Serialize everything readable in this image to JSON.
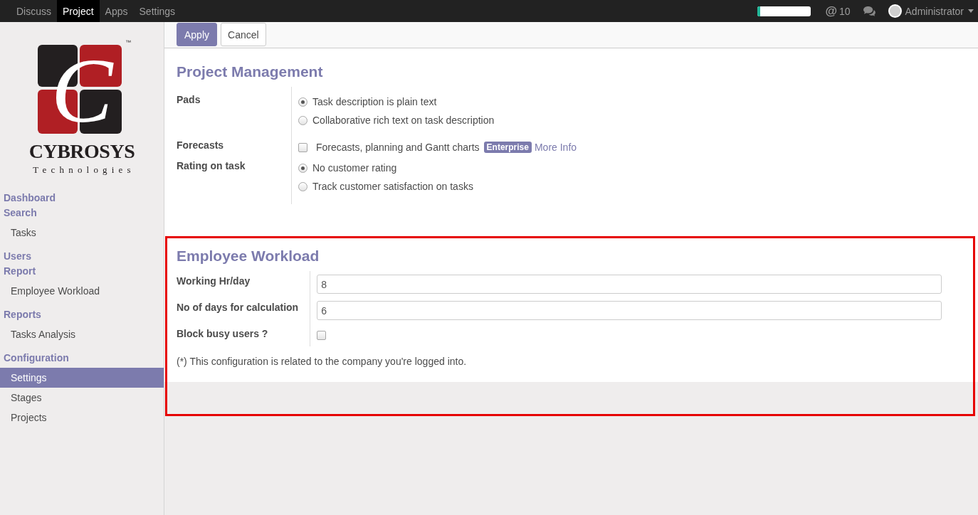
{
  "navbar": {
    "menus": [
      {
        "label": "Discuss",
        "selected": false
      },
      {
        "label": "Project",
        "selected": true
      },
      {
        "label": "Apps",
        "selected": false
      },
      {
        "label": "Settings",
        "selected": false
      }
    ],
    "planner": {
      "level": 0.05
    },
    "mentions": {
      "symbol": "@",
      "count": "10"
    },
    "user": {
      "name": "Administrator"
    }
  },
  "sidebar": {
    "logo": {
      "monogram": "C",
      "trademark": "™",
      "name": "CYBROSYS",
      "tagline": "Technologies"
    },
    "sections": [
      {
        "label": "Dashboard"
      },
      {
        "label": "Search",
        "children": [
          {
            "label": "Tasks",
            "selected": false
          }
        ]
      },
      {
        "label": "Users"
      },
      {
        "label": "Report",
        "children": [
          {
            "label": "Employee Workload",
            "selected": false
          }
        ]
      },
      {
        "label": "Reports",
        "children": [
          {
            "label": "Tasks Analysis",
            "selected": false
          }
        ]
      },
      {
        "label": "Configuration",
        "children": [
          {
            "label": "Settings",
            "selected": true
          },
          {
            "label": "Stages",
            "selected": false
          },
          {
            "label": "Projects",
            "selected": false
          }
        ]
      }
    ]
  },
  "control_panel": {
    "buttons": [
      {
        "label": "Apply",
        "kind": "primary"
      },
      {
        "label": "Cancel",
        "kind": "secondary"
      }
    ]
  },
  "sections": [
    {
      "title": "Project Management",
      "highlighted": false,
      "fields": [
        {
          "label": "Pads",
          "kind": "radio",
          "options": [
            {
              "label": "Task description is plain text",
              "selected": true
            },
            {
              "label": "Collaborative rich text on task description",
              "selected": false
            }
          ]
        },
        {
          "label": "Forecasts",
          "kind": "checkboxes",
          "options": [
            {
              "label": "Forecasts, planning and Gantt charts",
              "checked": false,
              "badge": "Enterprise",
              "link": "More Info"
            }
          ]
        },
        {
          "label": "Rating on task",
          "kind": "radio",
          "options": [
            {
              "label": "No customer rating",
              "selected": true
            },
            {
              "label": "Track customer satisfaction on tasks",
              "selected": false
            }
          ]
        }
      ]
    },
    {
      "title": "Employee Workload",
      "highlighted": true,
      "fields": [
        {
          "label": "Working Hr/day",
          "kind": "input",
          "value": "8"
        },
        {
          "label": "No of days for calculation",
          "kind": "input",
          "value": "6"
        },
        {
          "label": "Block busy users ?",
          "kind": "checkbox",
          "checked": false
        }
      ],
      "note": "(*) This configuration is related to the company you're logged into."
    }
  ]
}
